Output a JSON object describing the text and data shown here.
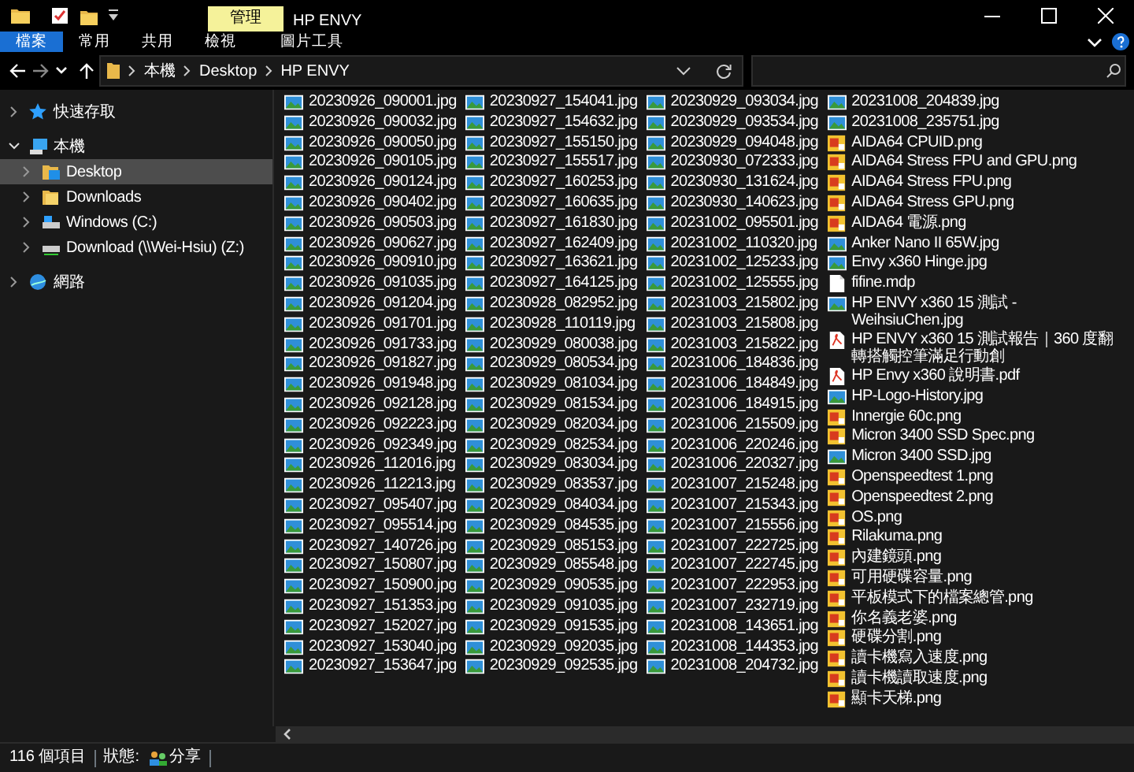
{
  "window": {
    "title": "HP ENVY"
  },
  "context_tab": {
    "label": "管理"
  },
  "ribbon_tabs": [
    {
      "label": "檔案",
      "selected": true
    },
    {
      "label": "常用",
      "selected": false
    },
    {
      "label": "共用",
      "selected": false
    },
    {
      "label": "檢視",
      "selected": false
    },
    {
      "label": "圖片工具",
      "selected": false
    }
  ],
  "address": {
    "path": [
      "本機",
      "Desktop",
      "HP ENVY"
    ]
  },
  "sidebar": [
    {
      "label": "快速存取",
      "kind": "star",
      "expanded": false,
      "selected": false
    },
    {
      "label": "本機",
      "kind": "pc",
      "expanded": true,
      "selected": false,
      "children": [
        {
          "label": "Desktop",
          "kind": "desktop",
          "expanded": false,
          "selected": true
        },
        {
          "label": "Downloads",
          "kind": "folder",
          "expanded": false,
          "selected": false
        },
        {
          "label": "Windows (C:)",
          "kind": "drive",
          "expanded": false,
          "selected": false
        },
        {
          "label": "Download (\\\\Wei-Hsiu) (Z:)",
          "kind": "netdrive",
          "expanded": false,
          "selected": false
        }
      ]
    },
    {
      "label": "網路",
      "kind": "network",
      "expanded": false,
      "selected": false
    }
  ],
  "files": [
    {
      "name": "20230926_090001.jpg",
      "kind": "image"
    },
    {
      "name": "20230926_090032.jpg",
      "kind": "image"
    },
    {
      "name": "20230926_090050.jpg",
      "kind": "image"
    },
    {
      "name": "20230926_090105.jpg",
      "kind": "image"
    },
    {
      "name": "20230926_090124.jpg",
      "kind": "image"
    },
    {
      "name": "20230926_090402.jpg",
      "kind": "image"
    },
    {
      "name": "20230926_090503.jpg",
      "kind": "image"
    },
    {
      "name": "20230926_090627.jpg",
      "kind": "image"
    },
    {
      "name": "20230926_090910.jpg",
      "kind": "image"
    },
    {
      "name": "20230926_091035.jpg",
      "kind": "image"
    },
    {
      "name": "20230926_091204.jpg",
      "kind": "image"
    },
    {
      "name": "20230926_091701.jpg",
      "kind": "image"
    },
    {
      "name": "20230926_091733.jpg",
      "kind": "image"
    },
    {
      "name": "20230926_091827.jpg",
      "kind": "image"
    },
    {
      "name": "20230926_091948.jpg",
      "kind": "image"
    },
    {
      "name": "20230926_092128.jpg",
      "kind": "image"
    },
    {
      "name": "20230926_092223.jpg",
      "kind": "image"
    },
    {
      "name": "20230926_092349.jpg",
      "kind": "image"
    },
    {
      "name": "20230926_112016.jpg",
      "kind": "image"
    },
    {
      "name": "20230926_112213.jpg",
      "kind": "image"
    },
    {
      "name": "20230927_095407.jpg",
      "kind": "image"
    },
    {
      "name": "20230927_095514.jpg",
      "kind": "image"
    },
    {
      "name": "20230927_140726.jpg",
      "kind": "image"
    },
    {
      "name": "20230927_150807.jpg",
      "kind": "image"
    },
    {
      "name": "20230927_150900.jpg",
      "kind": "image"
    },
    {
      "name": "20230927_151353.jpg",
      "kind": "image"
    },
    {
      "name": "20230927_152027.jpg",
      "kind": "image"
    },
    {
      "name": "20230927_153040.jpg",
      "kind": "image"
    },
    {
      "name": "20230927_153647.jpg",
      "kind": "image"
    },
    {
      "name": "20230927_154041.jpg",
      "kind": "image"
    },
    {
      "name": "20230927_154632.jpg",
      "kind": "image"
    },
    {
      "name": "20230927_155150.jpg",
      "kind": "image"
    },
    {
      "name": "20230927_155517.jpg",
      "kind": "image"
    },
    {
      "name": "20230927_160253.jpg",
      "kind": "image"
    },
    {
      "name": "20230927_160635.jpg",
      "kind": "image"
    },
    {
      "name": "20230927_161830.jpg",
      "kind": "image"
    },
    {
      "name": "20230927_162409.jpg",
      "kind": "image"
    },
    {
      "name": "20230927_163621.jpg",
      "kind": "image"
    },
    {
      "name": "20230927_164125.jpg",
      "kind": "image"
    },
    {
      "name": "20230928_082952.jpg",
      "kind": "image"
    },
    {
      "name": "20230928_110119.jpg",
      "kind": "image"
    },
    {
      "name": "20230929_080038.jpg",
      "kind": "image"
    },
    {
      "name": "20230929_080534.jpg",
      "kind": "image"
    },
    {
      "name": "20230929_081034.jpg",
      "kind": "image"
    },
    {
      "name": "20230929_081534.jpg",
      "kind": "image"
    },
    {
      "name": "20230929_082034.jpg",
      "kind": "image"
    },
    {
      "name": "20230929_082534.jpg",
      "kind": "image"
    },
    {
      "name": "20230929_083034.jpg",
      "kind": "image"
    },
    {
      "name": "20230929_083537.jpg",
      "kind": "image"
    },
    {
      "name": "20230929_084034.jpg",
      "kind": "image"
    },
    {
      "name": "20230929_084535.jpg",
      "kind": "image"
    },
    {
      "name": "20230929_085153.jpg",
      "kind": "image"
    },
    {
      "name": "20230929_085548.jpg",
      "kind": "image"
    },
    {
      "name": "20230929_090535.jpg",
      "kind": "image"
    },
    {
      "name": "20230929_091035.jpg",
      "kind": "image"
    },
    {
      "name": "20230929_091535.jpg",
      "kind": "image"
    },
    {
      "name": "20230929_092035.jpg",
      "kind": "image"
    },
    {
      "name": "20230929_092535.jpg",
      "kind": "image"
    },
    {
      "name": "20230929_093034.jpg",
      "kind": "image"
    },
    {
      "name": "20230929_093534.jpg",
      "kind": "image"
    },
    {
      "name": "20230929_094048.jpg",
      "kind": "image"
    },
    {
      "name": "20230930_072333.jpg",
      "kind": "image"
    },
    {
      "name": "20230930_131624.jpg",
      "kind": "image"
    },
    {
      "name": "20230930_140623.jpg",
      "kind": "image"
    },
    {
      "name": "20231002_095501.jpg",
      "kind": "image"
    },
    {
      "name": "20231002_110320.jpg",
      "kind": "image"
    },
    {
      "name": "20231002_125233.jpg",
      "kind": "image"
    },
    {
      "name": "20231002_125555.jpg",
      "kind": "image"
    },
    {
      "name": "20231003_215802.jpg",
      "kind": "image"
    },
    {
      "name": "20231003_215808.jpg",
      "kind": "image"
    },
    {
      "name": "20231003_215822.jpg",
      "kind": "image"
    },
    {
      "name": "20231006_184836.jpg",
      "kind": "image"
    },
    {
      "name": "20231006_184849.jpg",
      "kind": "image"
    },
    {
      "name": "20231006_184915.jpg",
      "kind": "image"
    },
    {
      "name": "20231006_215509.jpg",
      "kind": "image"
    },
    {
      "name": "20231006_220246.jpg",
      "kind": "image"
    },
    {
      "name": "20231006_220327.jpg",
      "kind": "image"
    },
    {
      "name": "20231007_215248.jpg",
      "kind": "image"
    },
    {
      "name": "20231007_215343.jpg",
      "kind": "image"
    },
    {
      "name": "20231007_215556.jpg",
      "kind": "image"
    },
    {
      "name": "20231007_222725.jpg",
      "kind": "image"
    },
    {
      "name": "20231007_222745.jpg",
      "kind": "image"
    },
    {
      "name": "20231007_222953.jpg",
      "kind": "image"
    },
    {
      "name": "20231007_232719.jpg",
      "kind": "image"
    },
    {
      "name": "20231008_143651.jpg",
      "kind": "image"
    },
    {
      "name": "20231008_144353.jpg",
      "kind": "image"
    },
    {
      "name": "20231008_204732.jpg",
      "kind": "image"
    },
    {
      "name": "20231008_204839.jpg",
      "kind": "image"
    },
    {
      "name": "20231008_235751.jpg",
      "kind": "image"
    },
    {
      "name": "AIDA64 CPUID.png",
      "kind": "png"
    },
    {
      "name": "AIDA64 Stress FPU and GPU.png",
      "kind": "png"
    },
    {
      "name": "AIDA64 Stress FPU.png",
      "kind": "png"
    },
    {
      "name": "AIDA64 Stress GPU.png",
      "kind": "png"
    },
    {
      "name": "AIDA64 電源.png",
      "kind": "png"
    },
    {
      "name": "Anker Nano II 65W.jpg",
      "kind": "image"
    },
    {
      "name": "Envy x360 Hinge.jpg",
      "kind": "image"
    },
    {
      "name": "fifine.mdp",
      "kind": "file"
    },
    {
      "name": "HP ENVY x360 15 測試 - WeihsiuChen.jpg",
      "kind": "image"
    },
    {
      "name": "HP ENVY x360 15 測試報告｜360 度翻轉搭觸控筆滿足行動創",
      "kind": "pdf"
    },
    {
      "name": "HP Envy x360 說明書.pdf",
      "kind": "pdf"
    },
    {
      "name": "HP-Logo-History.jpg",
      "kind": "image"
    },
    {
      "name": "Innergie 60c.png",
      "kind": "png"
    },
    {
      "name": "Micron 3400 SSD Spec.png",
      "kind": "png"
    },
    {
      "name": "Micron 3400 SSD.jpg",
      "kind": "image"
    },
    {
      "name": "Openspeedtest 1.png",
      "kind": "png"
    },
    {
      "name": "Openspeedtest 2.png",
      "kind": "png"
    },
    {
      "name": "OS.png",
      "kind": "png"
    },
    {
      "name": "Rilakuma.png",
      "kind": "png"
    },
    {
      "name": "內建鏡頭.png",
      "kind": "png"
    },
    {
      "name": "可用硬碟容量.png",
      "kind": "png"
    },
    {
      "name": "平板模式下的檔案總管.png",
      "kind": "png"
    },
    {
      "name": "你名義老婆.png",
      "kind": "png"
    },
    {
      "name": "硬碟分割.png",
      "kind": "png"
    },
    {
      "name": "讀卡機寫入速度.png",
      "kind": "png"
    },
    {
      "name": "讀卡機讀取速度.png",
      "kind": "png"
    },
    {
      "name": "顯卡天梯.png",
      "kind": "png"
    }
  ],
  "status_bar": {
    "count": "116 個項目",
    "state_label": "狀態:",
    "share": "分享"
  }
}
